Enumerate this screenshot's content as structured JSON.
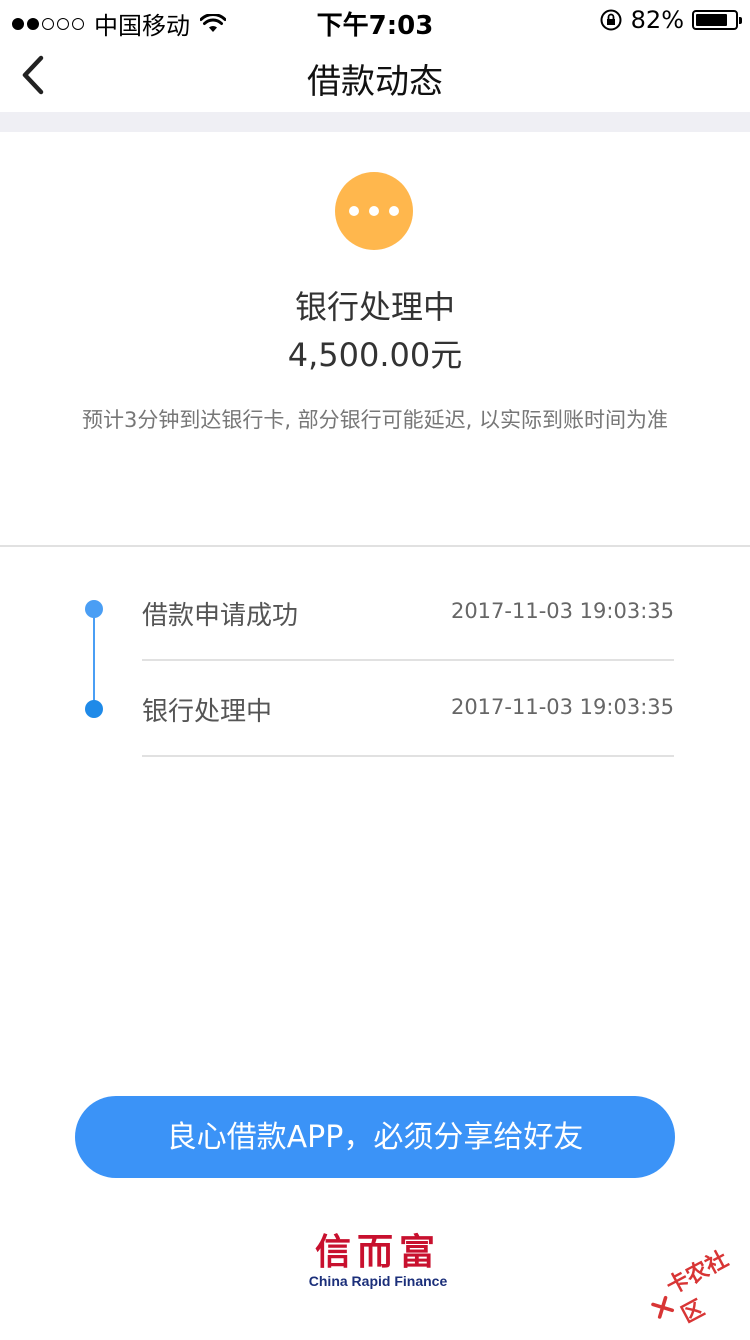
{
  "status_bar": {
    "carrier": "中国移动",
    "time": "下午7:03",
    "battery": "82%",
    "battery_level": 0.82
  },
  "nav": {
    "title": "借款动态"
  },
  "status": {
    "icon": "more-dots-icon",
    "icon_color": "#ffb74d",
    "title": "银行处理中",
    "amount": "4,500.00元",
    "note": "预计3分钟到达银行卡, 部分银行可能延迟, 以实际到账时间为准"
  },
  "timeline": [
    {
      "label": "借款申请成功",
      "time": "2017-11-03 19:03:35"
    },
    {
      "label": "银行处理中",
      "time": "2017-11-03 19:03:35"
    }
  ],
  "share_button": {
    "label": "良心借款APP，必须分享给好友",
    "color": "#3b93f7"
  },
  "logo": {
    "name_cn": "信而富",
    "name_en": "China Rapid Finance"
  },
  "watermark": {
    "text": "卡农社区"
  }
}
